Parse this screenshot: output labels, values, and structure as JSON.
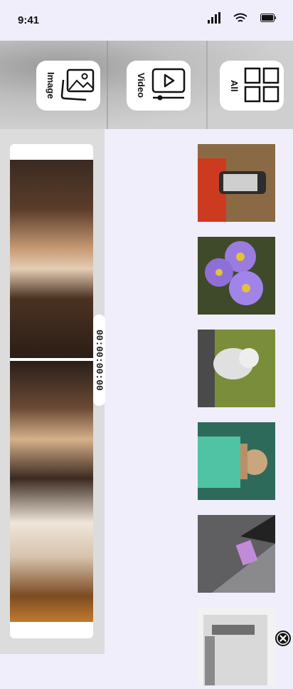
{
  "status_bar": {
    "time": "9:41"
  },
  "header": {
    "tiles": [
      {
        "label": "Image",
        "icon": "images-icon"
      },
      {
        "label": "Video",
        "icon": "video-player-icon"
      },
      {
        "label": "All",
        "icon": "grid-icon"
      }
    ]
  },
  "editor": {
    "timecode": "00:00:00:00"
  },
  "gallery": {
    "items": [
      {
        "name": "person-holding-phone",
        "colors": [
          "#8a6a44",
          "#cc3b1f",
          "#2d2d2d"
        ]
      },
      {
        "name": "purple-daisies",
        "colors": [
          "#3f4a2a",
          "#9a7be0",
          "#e3c23a"
        ]
      },
      {
        "name": "white-cat",
        "colors": [
          "#7a8d3a",
          "#d8d8d8",
          "#4a4a4a"
        ]
      },
      {
        "name": "person-green-shirt",
        "colors": [
          "#2e6a5a",
          "#4fc3a3",
          "#caa67e"
        ]
      },
      {
        "name": "laptop-webflow-sticker",
        "colors": [
          "#5f5f62",
          "#8a8a8d",
          "#c28bd8"
        ]
      },
      {
        "name": "3d-printer",
        "colors": [
          "#d9d9d9",
          "#6f6f6f",
          "#f2f2f2"
        ]
      }
    ]
  }
}
